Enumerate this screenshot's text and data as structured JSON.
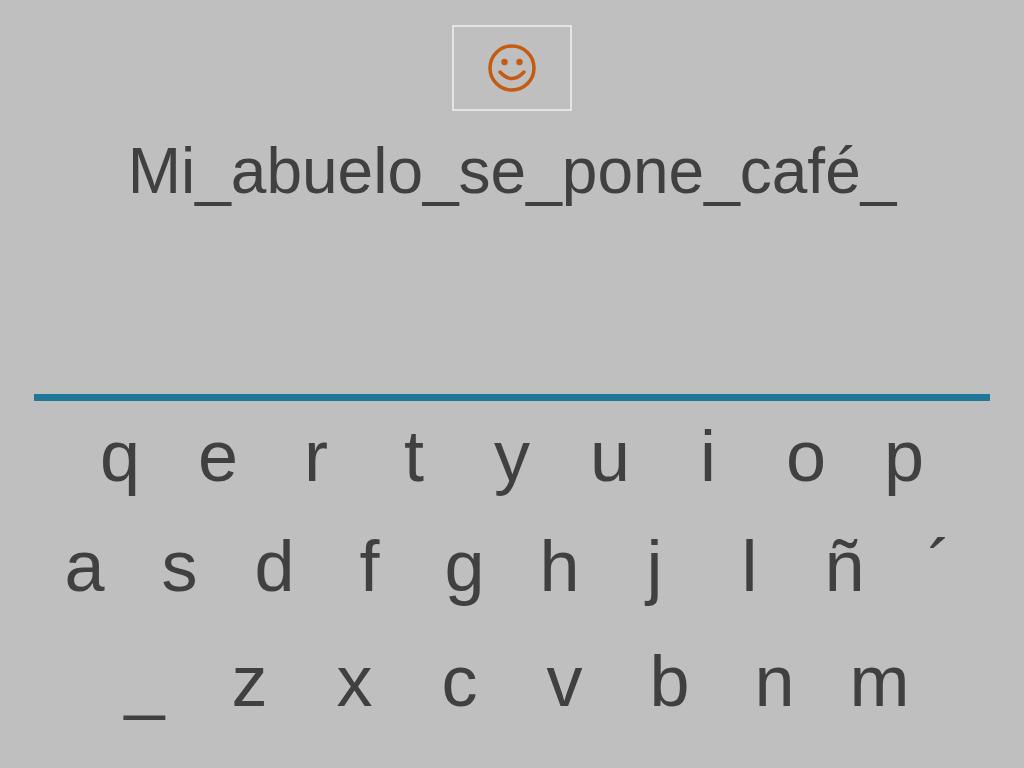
{
  "sentence": "Mi_abuelo_se_pone_café_",
  "keyboard": {
    "rows": [
      {
        "keys": [
          "q",
          "e",
          "r",
          "t",
          "y",
          "u",
          "i",
          "o",
          "p"
        ]
      },
      {
        "keys": [
          "a",
          "s",
          "d",
          "f",
          "g",
          "h",
          "j",
          "l",
          "ñ",
          "´"
        ]
      },
      {
        "keys": [
          "_",
          "z",
          "x",
          "c",
          "v",
          "b",
          "n",
          "m"
        ]
      }
    ]
  }
}
